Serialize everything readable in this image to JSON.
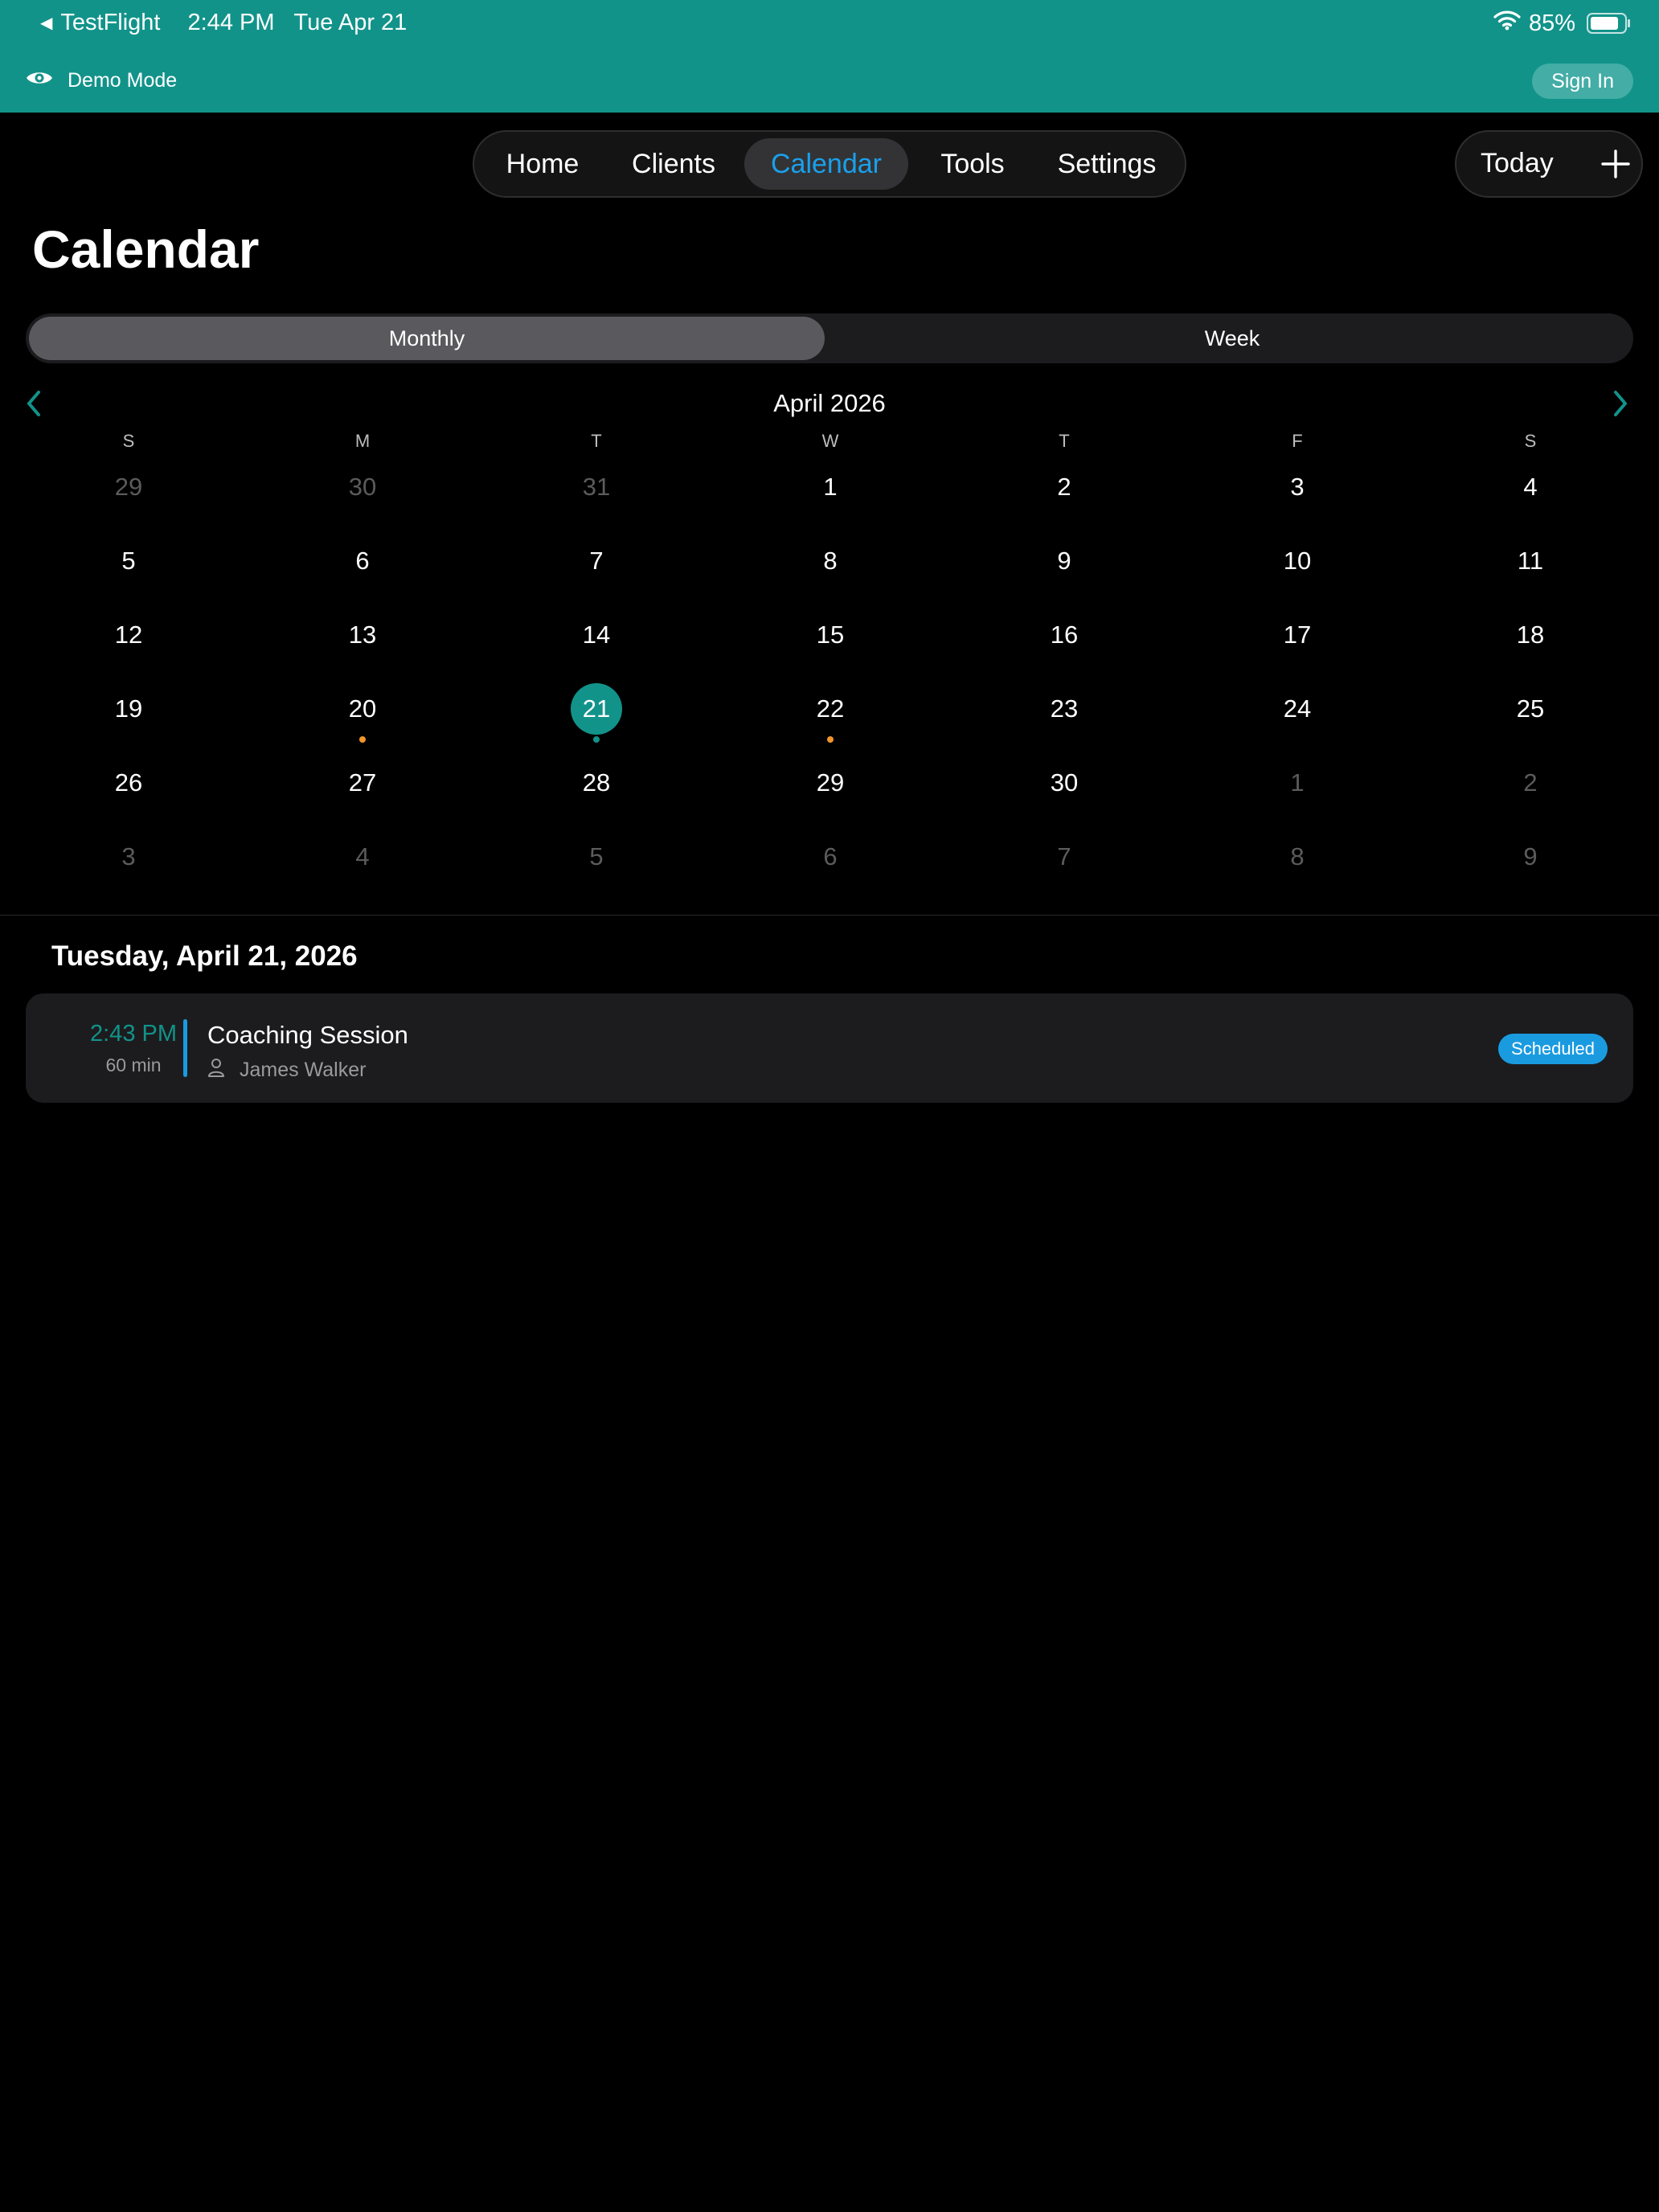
{
  "status_bar": {
    "back_app": "TestFlight",
    "time": "2:44 PM",
    "date": "Tue Apr 21",
    "battery": "85%"
  },
  "demo_bar": {
    "label": "Demo Mode",
    "sign_in": "Sign In"
  },
  "nav": {
    "tabs": [
      "Home",
      "Clients",
      "Calendar",
      "Tools",
      "Settings"
    ],
    "active": "Calendar",
    "today": "Today"
  },
  "page_title": "Calendar",
  "view_toggle": {
    "options": [
      "Monthly",
      "Week"
    ],
    "selected": "Monthly"
  },
  "calendar": {
    "month_title": "April 2026",
    "weekdays": [
      "S",
      "M",
      "T",
      "W",
      "T",
      "F",
      "S"
    ],
    "weeks": [
      [
        "29",
        "30",
        "31",
        "1",
        "2",
        "3",
        "4"
      ],
      [
        "5",
        "6",
        "7",
        "8",
        "9",
        "10",
        "11"
      ],
      [
        "12",
        "13",
        "14",
        "15",
        "16",
        "17",
        "18"
      ],
      [
        "19",
        "20",
        "21",
        "22",
        "23",
        "24",
        "25"
      ],
      [
        "26",
        "27",
        "28",
        "29",
        "30",
        "1",
        "2"
      ],
      [
        "3",
        "4",
        "5",
        "6",
        "7",
        "8",
        "9"
      ]
    ],
    "muted_cells": [
      [
        0,
        0
      ],
      [
        0,
        1
      ],
      [
        0,
        2
      ],
      [
        4,
        5
      ],
      [
        4,
        6
      ],
      [
        5,
        0
      ],
      [
        5,
        1
      ],
      [
        5,
        2
      ],
      [
        5,
        3
      ],
      [
        5,
        4
      ],
      [
        5,
        5
      ],
      [
        5,
        6
      ]
    ],
    "selected_cell": [
      3,
      2
    ],
    "event_dots": [
      {
        "cell": [
          3,
          1
        ],
        "color": "#f0962a"
      },
      {
        "cell": [
          3,
          2
        ],
        "color": "#12938a"
      },
      {
        "cell": [
          3,
          3
        ],
        "color": "#f0962a"
      }
    ]
  },
  "selected_date_label": "Tuesday, April 21, 2026",
  "events": [
    {
      "time": "2:43 PM",
      "duration": "60 min",
      "title": "Coaching Session",
      "client": "James Walker",
      "status": "Scheduled"
    }
  ],
  "colors": {
    "accent": "#12938a",
    "nav_active": "#1aa0ec",
    "badge": "#1a9be0",
    "dot_orange": "#f0962a"
  }
}
